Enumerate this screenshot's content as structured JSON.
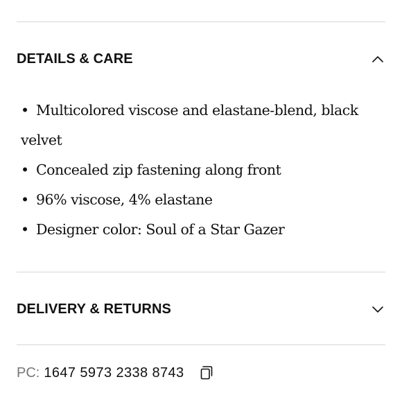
{
  "details_care": {
    "title": "DETAILS & CARE",
    "expanded": true,
    "toggle_icon": "chevron-up-icon",
    "items": [
      "Multicolored viscose and elastane-blend, black velvet",
      "Concealed zip fastening along front",
      "96% viscose, 4% elastane",
      "Designer color: Soul of a Star Gazer"
    ]
  },
  "delivery_returns": {
    "title": "DELIVERY & RETURNS",
    "expanded": false,
    "toggle_icon": "chevron-down-icon"
  },
  "product_code": {
    "label": "PC:",
    "value": "1647 5973 2338 8743",
    "copy_icon": "copy-icon"
  },
  "colors": {
    "text": "#111111",
    "muted": "#777777",
    "divider": "#d6d6d6"
  }
}
